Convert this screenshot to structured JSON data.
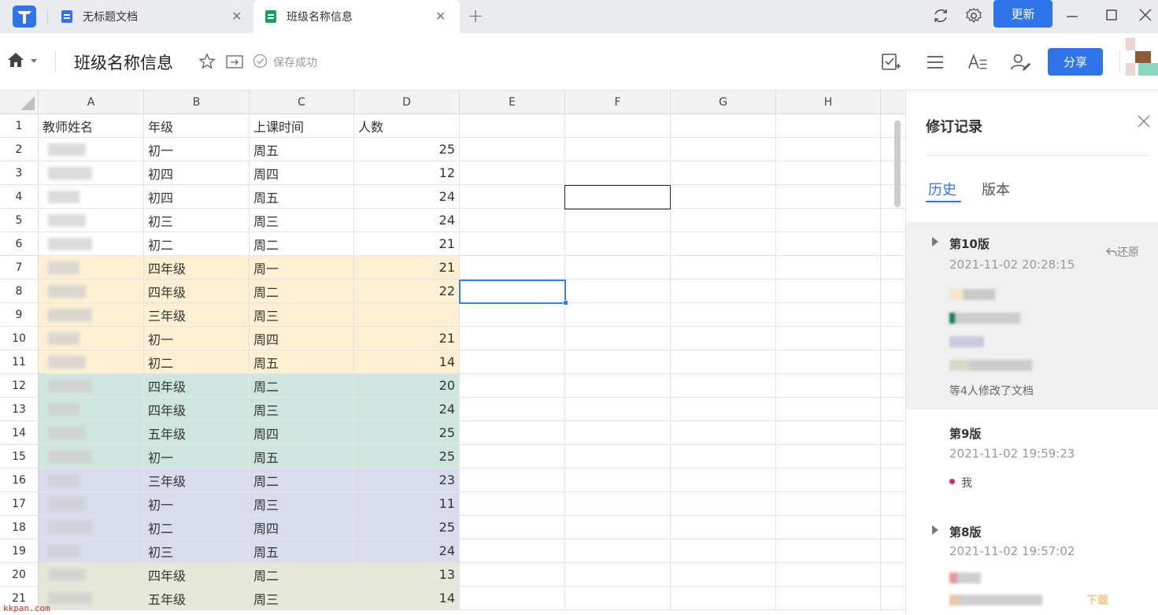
{
  "tabs": [
    {
      "title": "无标题文档",
      "icon": "doc-icon",
      "color": "#2f74e8"
    },
    {
      "title": "班级名称信息",
      "icon": "sheet-icon",
      "color": "#18a058"
    }
  ],
  "titlebar": {
    "update_label": "更新"
  },
  "toolbar": {
    "doc_title": "班级名称信息",
    "saved_text": "保存成功",
    "share_label": "分享"
  },
  "sheet": {
    "columns": [
      "A",
      "B",
      "C",
      "D",
      "E",
      "F",
      "G",
      "H"
    ],
    "rows": [
      {
        "n": "1",
        "a": "教师姓名",
        "b": "年级",
        "c": "上课时间",
        "d": "人数",
        "fill": "#ffffff"
      },
      {
        "n": "2",
        "a": "",
        "b": "初一",
        "c": "周五",
        "d": "25",
        "fill": "#ffffff"
      },
      {
        "n": "3",
        "a": "",
        "b": "初四",
        "c": "周四",
        "d": "12",
        "fill": "#ffffff"
      },
      {
        "n": "4",
        "a": "",
        "b": "初四",
        "c": "周五",
        "d": "24",
        "fill": "#ffffff"
      },
      {
        "n": "5",
        "a": "",
        "b": "初三",
        "c": "周三",
        "d": "24",
        "fill": "#ffffff"
      },
      {
        "n": "6",
        "a": "",
        "b": "初二",
        "c": "周二",
        "d": "21",
        "fill": "#ffffff"
      },
      {
        "n": "7",
        "a": "",
        "b": "四年级",
        "c": "周一",
        "d": "21",
        "fill": "#fdf0d3"
      },
      {
        "n": "8",
        "a": "",
        "b": "四年级",
        "c": "周二",
        "d": "22",
        "fill": "#fdf0d3"
      },
      {
        "n": "9",
        "a": "",
        "b": "三年级",
        "c": "周三",
        "d": "",
        "fill": "#fdf0d3"
      },
      {
        "n": "10",
        "a": "",
        "b": "初一",
        "c": "周四",
        "d": "21",
        "fill": "#fdf0d3"
      },
      {
        "n": "11",
        "a": "",
        "b": "初二",
        "c": "周五",
        "d": "14",
        "fill": "#fdf0d3"
      },
      {
        "n": "12",
        "a": "",
        "b": "四年级",
        "c": "周二",
        "d": "20",
        "fill": "#cfe6e0"
      },
      {
        "n": "13",
        "a": "",
        "b": "四年级",
        "c": "周三",
        "d": "24",
        "fill": "#cfe6e0"
      },
      {
        "n": "14",
        "a": "",
        "b": "五年级",
        "c": "周四",
        "d": "25",
        "fill": "#cfe6e0"
      },
      {
        "n": "15",
        "a": "",
        "b": "初一",
        "c": "周五",
        "d": "25",
        "fill": "#cfe6e0"
      },
      {
        "n": "16",
        "a": "",
        "b": "三年级",
        "c": "周二",
        "d": "23",
        "fill": "#d9dbef"
      },
      {
        "n": "17",
        "a": "",
        "b": "初一",
        "c": "周三",
        "d": "11",
        "fill": "#d9dbef"
      },
      {
        "n": "18",
        "a": "",
        "b": "初二",
        "c": "周四",
        "d": "25",
        "fill": "#d9dbef"
      },
      {
        "n": "19",
        "a": "",
        "b": "初三",
        "c": "周五",
        "d": "24",
        "fill": "#d9dbef"
      },
      {
        "n": "20",
        "a": "",
        "b": "四年级",
        "c": "周二",
        "d": "13",
        "fill": "#e6e8da"
      },
      {
        "n": "21",
        "a": "",
        "b": "五年级",
        "c": "周三",
        "d": "14",
        "fill": "#e6e8da"
      }
    ]
  },
  "panel": {
    "title": "修订记录",
    "tabs": [
      "历史",
      "版本"
    ],
    "restore_label": "还原",
    "versions": [
      {
        "name": "第10版",
        "time": "2021-11-02 20:28:15",
        "more": "等4人修改了文档"
      },
      {
        "name": "第9版",
        "time": "2021-11-02 19:59:23",
        "editor": "我"
      },
      {
        "name": "第8版",
        "time": "2021-11-02 19:57:02"
      }
    ]
  },
  "watermarks": {
    "left": "kkpan.com",
    "right": "下载"
  }
}
